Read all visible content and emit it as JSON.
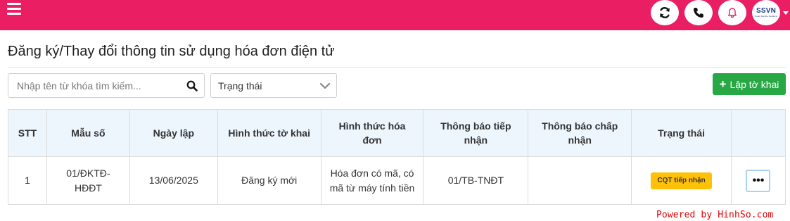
{
  "header": {
    "avatar_logo": "SSVN",
    "avatar_sub": "Smart Service Solutions",
    "colors": {
      "bar": "#e91e63",
      "icon_fill": "#ffffff"
    },
    "icons": [
      "menu-icon",
      "refresh-icon",
      "phone-icon",
      "bell-icon"
    ]
  },
  "page": {
    "title": "Đăng ký/Thay đổi thông tin sử dụng hóa đơn điện tử"
  },
  "toolbar": {
    "search_placeholder": "Nhập tên từ khóa tìm kiếm...",
    "status_select_value": "Trạng thái",
    "create_label": "Lập tờ khai",
    "create_color": "#28a745"
  },
  "table": {
    "headers": {
      "stt": "STT",
      "mau_so": "Mẫu số",
      "ngay_lap": "Ngày lập",
      "hinh_thuc_to_khai": "Hình thức tờ khai",
      "hinh_thuc_hoa_don_line1": "Hình thức hóa",
      "hinh_thuc_hoa_don_line2": "đơn",
      "tb_tiep_nhan_line1": "Thông báo tiếp",
      "tb_tiep_nhan_line2": "nhận",
      "tb_chap_nhan_line1": "Thông báo chấp",
      "tb_chap_nhan_line2": "nhận",
      "trang_thai": "Trạng thái",
      "actions": ""
    },
    "rows": [
      {
        "stt": "1",
        "mau_so_line1": "01/ĐKTĐ-",
        "mau_so_line2": "HĐĐT",
        "ngay_lap": "13/06/2025",
        "hinh_thuc_to_khai": "Đăng ký mới",
        "hinh_thuc_hoa_don_line1": "Hóa đơn có mã, có",
        "hinh_thuc_hoa_don_line2": "mã từ máy tính tiền",
        "tb_tiep_nhan": "01/TB-TNĐT",
        "tb_chap_nhan": "",
        "trang_thai": "CQT tiếp nhận",
        "status_color": "#ffc107",
        "more_label": "•••"
      }
    ]
  },
  "footer": {
    "credit": "Powered by HinhSo.com"
  }
}
